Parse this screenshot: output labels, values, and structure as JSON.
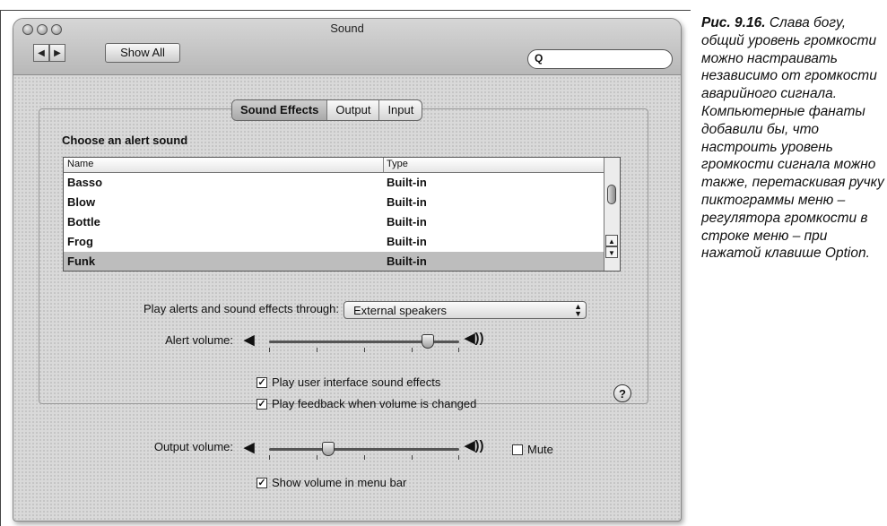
{
  "window": {
    "title": "Sound",
    "show_all_label": "Show All",
    "nav_back": "◀",
    "nav_forward": "▶",
    "search_placeholder": ""
  },
  "tabs": [
    {
      "label": "Sound Effects",
      "selected": true
    },
    {
      "label": "Output",
      "selected": false
    },
    {
      "label": "Input",
      "selected": false
    }
  ],
  "alert_section": {
    "heading": "Choose an alert sound",
    "columns": {
      "name": "Name",
      "type": "Type"
    },
    "rows": [
      {
        "name": "Basso",
        "type": "Built-in",
        "selected": false
      },
      {
        "name": "Blow",
        "type": "Built-in",
        "selected": false
      },
      {
        "name": "Bottle",
        "type": "Built-in",
        "selected": false
      },
      {
        "name": "Frog",
        "type": "Built-in",
        "selected": false
      },
      {
        "name": "Funk",
        "type": "Built-in",
        "selected": true
      }
    ]
  },
  "play_through": {
    "label": "Play alerts and sound effects through:",
    "value": "External speakers"
  },
  "alert_volume": {
    "label": "Alert volume:",
    "level": 0.86
  },
  "checkboxes": {
    "ui_sounds": {
      "label": "Play user interface sound effects",
      "checked": true
    },
    "feedback": {
      "label": "Play feedback when volume is changed",
      "checked": true
    },
    "show_volume": {
      "label": "Show volume in menu bar",
      "checked": true
    }
  },
  "help_label": "?",
  "output_volume": {
    "label": "Output volume:",
    "level": 0.3,
    "mute_label": "Mute",
    "muted": false
  },
  "caption": {
    "figure": "Рис. 9.16.",
    "text": "Слава богу, общий уровень громкости можно настраивать независимо от громкости аварийного сигнала. Компьютерные фанаты добавили бы, что настроить уровень громкости сигнала можно также, перетаскивая ручку пиктограммы меню – регулятора громкости в строке меню – при нажатой клавише Option."
  }
}
